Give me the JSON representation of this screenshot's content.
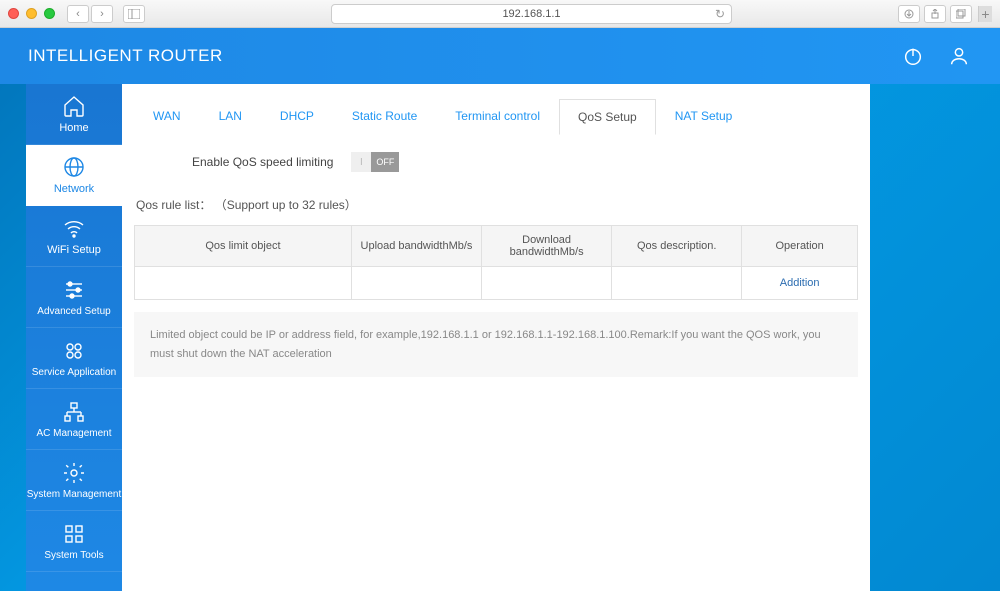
{
  "browser": {
    "url": "192.168.1.1"
  },
  "header": {
    "brand": "INTELLIGENT ROUTER"
  },
  "sidebar": {
    "items": [
      {
        "label": "Home"
      },
      {
        "label": "Network"
      },
      {
        "label": "WiFi Setup"
      },
      {
        "label": "Advanced Setup"
      },
      {
        "label": "Service Application"
      },
      {
        "label": "AC Management"
      },
      {
        "label": "System Management"
      },
      {
        "label": "System Tools"
      }
    ]
  },
  "tabs": [
    {
      "label": "WAN"
    },
    {
      "label": "LAN"
    },
    {
      "label": "DHCP"
    },
    {
      "label": "Static Route"
    },
    {
      "label": "Terminal control"
    },
    {
      "label": "QoS Setup"
    },
    {
      "label": "NAT Setup"
    }
  ],
  "qos": {
    "enable_label": "Enable QoS speed limiting",
    "toggle_on": "I",
    "toggle_off": "OFF",
    "rule_list_label": "Qos rule list：",
    "rule_list_hint": "（Support up to 32 rules）",
    "columns": {
      "object": "Qos limit object",
      "upload": "Upload bandwidthMb/s",
      "download": "Download bandwidthMb/s",
      "desc": "Qos description.",
      "operation": "Operation"
    },
    "addition": "Addition",
    "remark": "Limited object could be IP or address field, for example,192.168.1.1 or 192.168.1.1-192.168.1.100.Remark:If you want the QOS work, you must shut down the NAT acceleration"
  }
}
